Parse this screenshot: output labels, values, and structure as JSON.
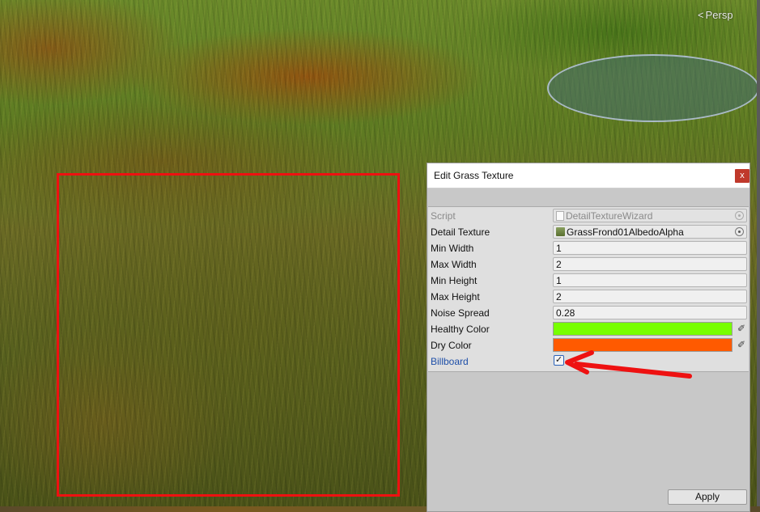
{
  "viewport": {
    "persp_label": "Persp",
    "persp_icon": "chevron-left-icon",
    "highlight_color": "#ee1111"
  },
  "wizard": {
    "title": "Edit Grass Texture",
    "close_label": "x",
    "fields": {
      "script": {
        "label": "Script",
        "value": "DetailTextureWizard"
      },
      "detail_texture": {
        "label": "Detail Texture",
        "value": "GrassFrond01AlbedoAlpha"
      },
      "min_width": {
        "label": "Min Width",
        "value": "1"
      },
      "max_width": {
        "label": "Max Width",
        "value": "2"
      },
      "min_height": {
        "label": "Min Height",
        "value": "1"
      },
      "max_height": {
        "label": "Max Height",
        "value": "2"
      },
      "noise_spread": {
        "label": "Noise Spread",
        "value": "0.28"
      },
      "healthy_color": {
        "label": "Healthy Color",
        "color": "#77ff00"
      },
      "dry_color": {
        "label": "Dry Color",
        "color": "#ff5a00"
      },
      "billboard": {
        "label": "Billboard",
        "checked": true,
        "check_glyph": "✓"
      }
    },
    "apply_label": "Apply"
  },
  "annotation": {
    "arrow_color": "#ee1111"
  }
}
